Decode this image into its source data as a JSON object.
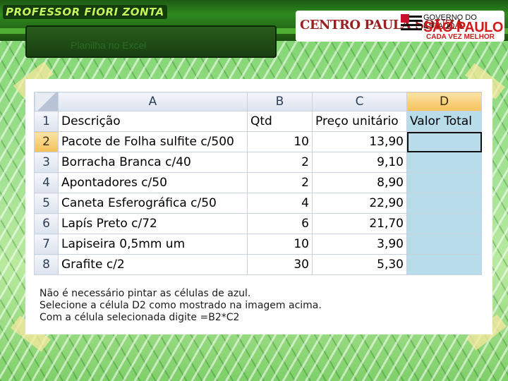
{
  "header": {
    "author_banner": "PROFESSOR FIORI ZONTA",
    "logo_left": "CENTRO PAULA SOUZA",
    "logo_gov_line": "GOVERNO DO ESTADO",
    "logo_state": "SÃO PAULO",
    "logo_slogan": "CADA VEZ MELHOR",
    "slide_title": "Planilha no Excel"
  },
  "sheet": {
    "columns": [
      "A",
      "B",
      "C",
      "D"
    ],
    "active_column": "D",
    "active_row": "2",
    "rows": [
      {
        "num": "1",
        "a": "Descrição",
        "b": "Qtd",
        "c": "Preço unitário",
        "d": "Valor Total"
      },
      {
        "num": "2",
        "a": "Pacote de Folha sulfite c/500",
        "b": "10",
        "c": "13,90",
        "d": ""
      },
      {
        "num": "3",
        "a": "Borracha Branca c/40",
        "b": "2",
        "c": "9,10",
        "d": ""
      },
      {
        "num": "4",
        "a": "Apontadores c/50",
        "b": "2",
        "c": "8,90",
        "d": ""
      },
      {
        "num": "5",
        "a": "Caneta Esferográfica c/50",
        "b": "4",
        "c": "22,90",
        "d": ""
      },
      {
        "num": "6",
        "a": "Lapís Preto c/72",
        "b": "6",
        "c": "21,70",
        "d": ""
      },
      {
        "num": "7",
        "a": "Lapiseira 0,5mm um",
        "b": "10",
        "c": "3,90",
        "d": ""
      },
      {
        "num": "8",
        "a": "Grafite c/2",
        "b": "30",
        "c": "5,30",
        "d": ""
      }
    ]
  },
  "instructions": [
    "Não é necessário pintar as células de azul.",
    "Selecione a célula D2 como mostrado na imagem acima.",
    "Com a célula selecionada digite =B2*C2"
  ],
  "colors": {
    "selected_cell": "#b8dce9",
    "active_header": "#f4c15a",
    "background": "#9fe08f"
  }
}
